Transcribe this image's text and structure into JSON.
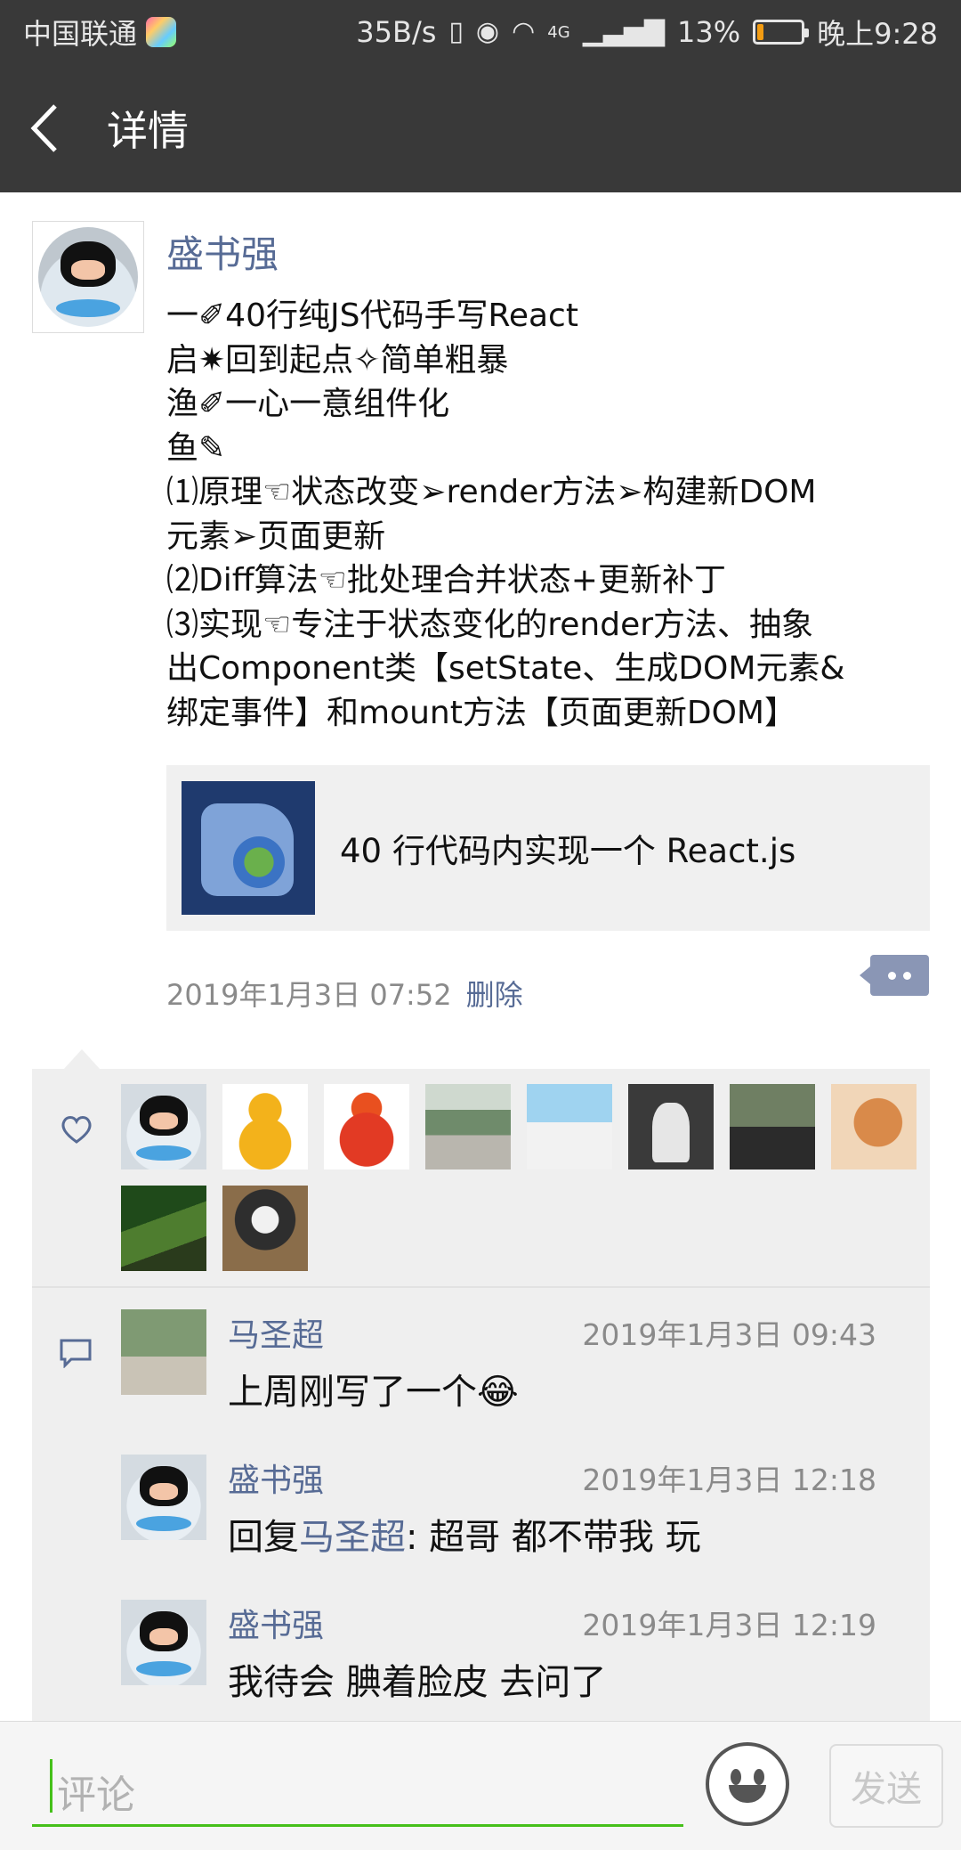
{
  "status_bar": {
    "carrier": "中国联通",
    "speed": "35B/s",
    "network": "4G",
    "battery": "13%",
    "battery_level": 0.13,
    "time": "晚上9:28"
  },
  "header": {
    "title": "详情"
  },
  "post": {
    "author": "盛书强",
    "lines": [
      "一✐40行纯JS代码手写React",
      "启✷回到起点✧简单粗暴",
      "渔✐一心一意组件化",
      "鱼✎",
      "⑴原理☜状态改变➢render方法➢构建新DOM",
      "元素➢页面更新",
      "⑵Diff算法☜批处理合并状态+更新补丁",
      "⑶实现☜专注于状态变化的render方法、抽象",
      "出Component类【setState、生成DOM元素&",
      "绑定事件】和mount方法【页面更新DOM】"
    ],
    "link_title": "40 行代码内实现一个 React.js",
    "timestamp": "2019年1月3日 07:52",
    "delete_label": "删除"
  },
  "likes": {
    "avatars": [
      "octocat",
      "gourd-yellow",
      "gourd-red",
      "photo-building",
      "photo-wedding",
      "photo-woman",
      "photo-man",
      "photo-cat",
      "photo-plants",
      "photo-panda"
    ]
  },
  "comments": [
    {
      "author": "马圣超",
      "time": "2019年1月3日 09:43",
      "text": "上周刚写了一个😂",
      "avatar": "photo-walk"
    },
    {
      "author": "盛书强",
      "time": "2019年1月3日 12:18",
      "reply_prefix": "回复",
      "reply_to": "马圣超",
      "text": ": 超哥 都不带我 玩",
      "avatar": "octocat"
    },
    {
      "author": "盛书强",
      "time": "2019年1月3日 12:19",
      "text": "我待会 腆着脸皮 去问了",
      "avatar": "octocat"
    }
  ],
  "input": {
    "placeholder": "评论",
    "send_label": "发送"
  },
  "colors": {
    "header_bg": "#393939",
    "name_link": "#576b95",
    "panel_bg": "#efefef",
    "accent_green": "#45c01a"
  }
}
